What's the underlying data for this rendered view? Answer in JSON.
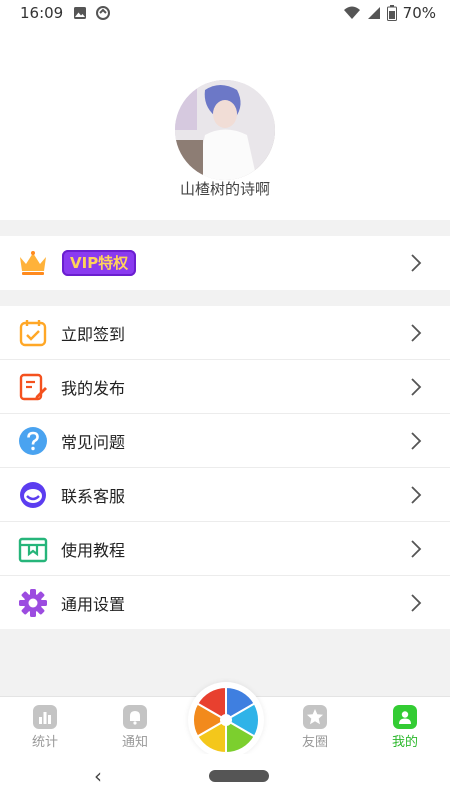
{
  "status_bar": {
    "time": "16:09",
    "battery": "70%"
  },
  "profile": {
    "username": "山楂树的诗啊"
  },
  "vip": {
    "label": "VIP特权"
  },
  "menu": {
    "items": [
      {
        "label": "立即签到",
        "icon": "calendar-check-icon"
      },
      {
        "label": "我的发布",
        "icon": "edit-document-icon"
      },
      {
        "label": "常见问题",
        "icon": "question-icon"
      },
      {
        "label": "联系客服",
        "icon": "customer-service-icon"
      },
      {
        "label": "使用教程",
        "icon": "book-icon"
      },
      {
        "label": "通用设置",
        "icon": "gear-icon"
      }
    ]
  },
  "bottom_nav": {
    "items": [
      {
        "label": "统计",
        "icon": "chart-icon",
        "active": false
      },
      {
        "label": "通知",
        "icon": "bell-icon",
        "active": false
      },
      {
        "label": "友圈",
        "icon": "star-icon",
        "active": false
      },
      {
        "label": "我的",
        "icon": "user-icon",
        "active": true
      }
    ]
  },
  "colors": {
    "accent": "#33cc33",
    "vip": "#8a3bf0",
    "vip_text": "#ffd35a"
  }
}
